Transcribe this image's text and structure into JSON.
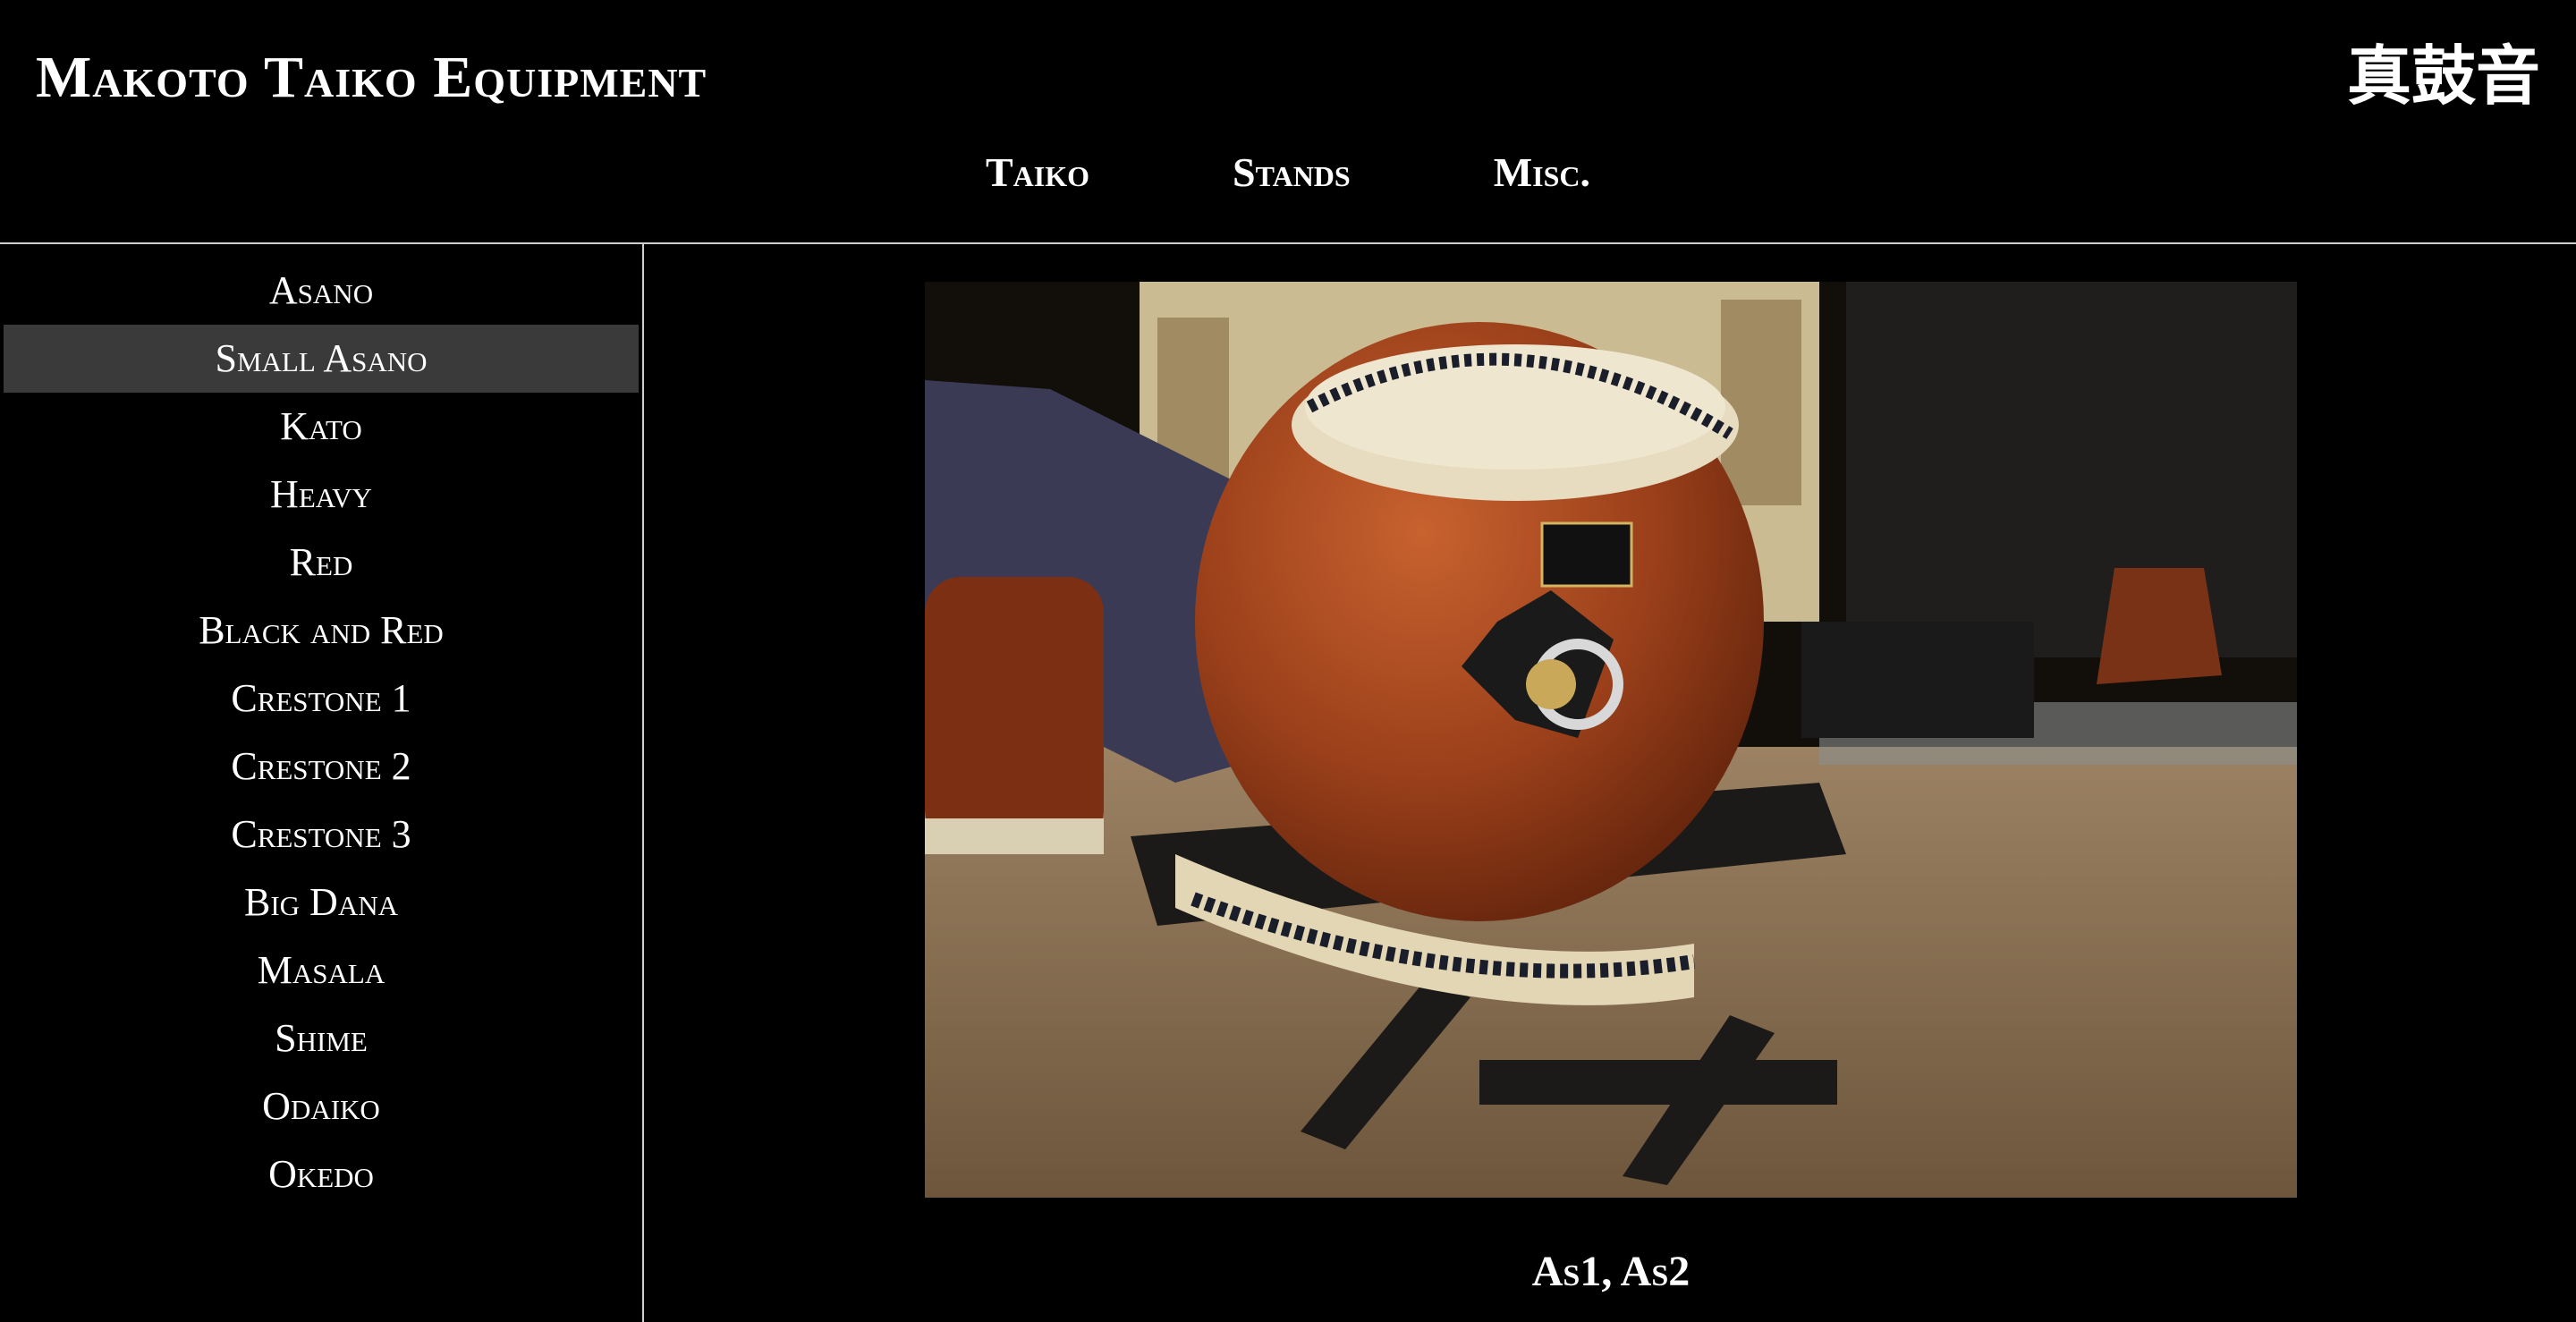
{
  "header": {
    "title": "Makoto Taiko Equipment",
    "logo_text": "真鼓音"
  },
  "nav": {
    "items": [
      {
        "label": "Taiko"
      },
      {
        "label": "Stands"
      },
      {
        "label": "Misc."
      }
    ]
  },
  "sidebar": {
    "items": [
      {
        "label": "Asano"
      },
      {
        "label": "Small Asano"
      },
      {
        "label": "Kato"
      },
      {
        "label": "Heavy"
      },
      {
        "label": "Red"
      },
      {
        "label": "Black and Red"
      },
      {
        "label": "Crestone 1"
      },
      {
        "label": "Crestone 2"
      },
      {
        "label": "Crestone 3"
      },
      {
        "label": "Big Dana"
      },
      {
        "label": "Masala"
      },
      {
        "label": "Shime"
      },
      {
        "label": "Odaiko"
      },
      {
        "label": "Okedo"
      }
    ],
    "selected": "Small Asano"
  },
  "main": {
    "caption": "As1, As2"
  },
  "colors": {
    "background": "#000000",
    "text": "#ffffff",
    "selected_bg": "#3a3a3a",
    "rule": "#cfcfcf"
  }
}
